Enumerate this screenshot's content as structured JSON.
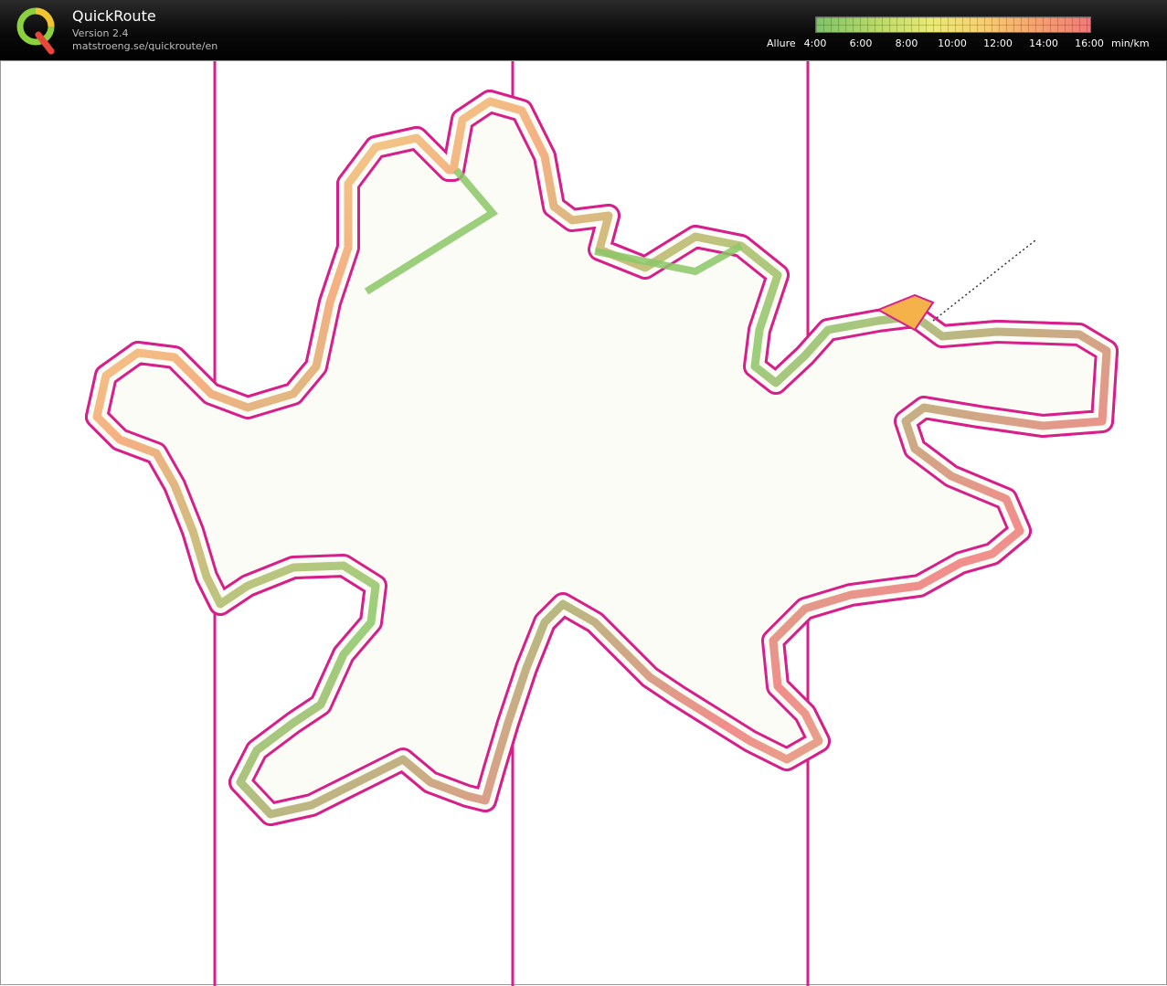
{
  "app": {
    "title": "QuickRoute",
    "version": "Version 2.4",
    "url": "matstroeng.se/quickroute/en"
  },
  "legend": {
    "label": "Allure",
    "ticks": [
      "4:00",
      "6:00",
      "8:00",
      "10:00",
      "12:00",
      "14:00",
      "16:00"
    ],
    "unit": "min/km",
    "colors": {
      "slow": "#f07a7a",
      "mid": "#e9ea78",
      "fast": "#7fc26b"
    }
  },
  "map": {
    "course_color": "#d61f8a",
    "route_color_fast": "#8bc766",
    "route_color_slow": "#e8463a",
    "symbols": [
      "start-triangle-icon",
      "control-marker-icon"
    ]
  }
}
